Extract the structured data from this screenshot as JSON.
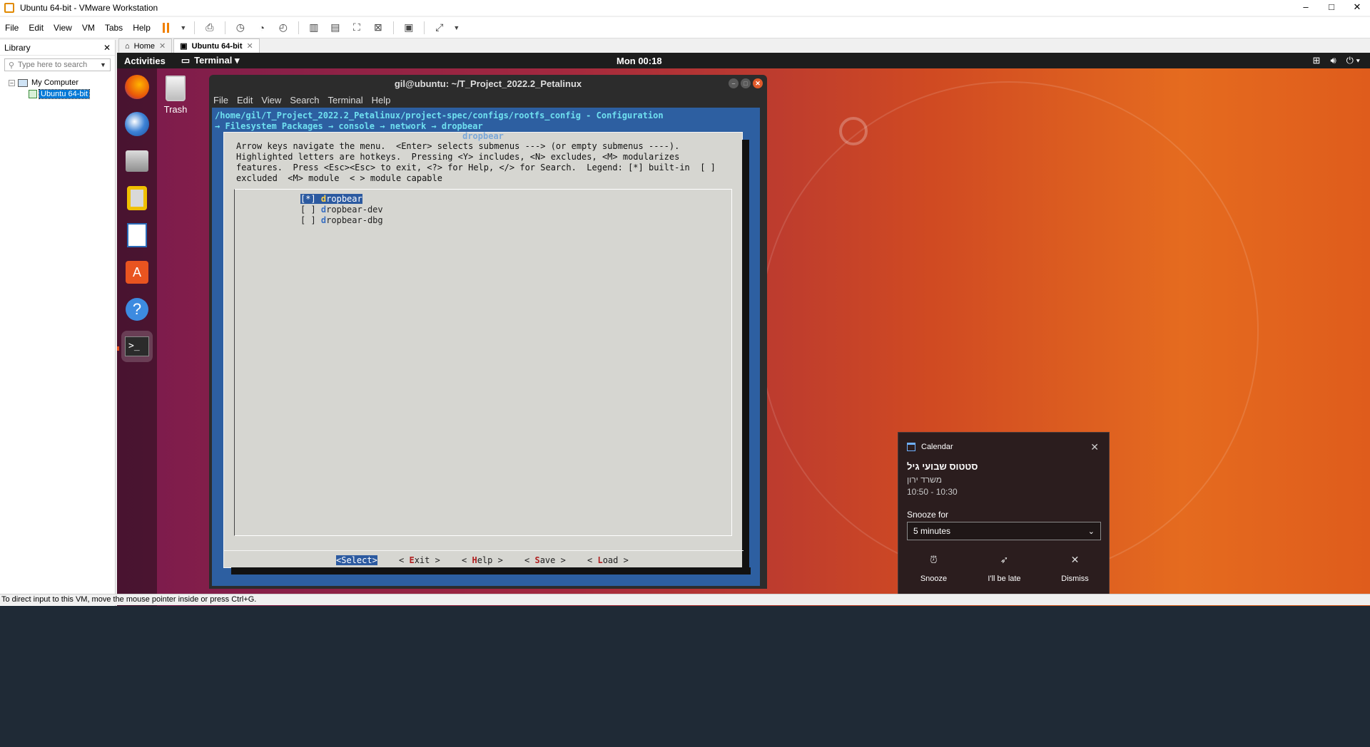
{
  "window": {
    "title": "Ubuntu 64-bit - VMware Workstation",
    "controls": [
      "–",
      "□",
      "✕"
    ]
  },
  "menu": [
    "File",
    "Edit",
    "View",
    "VM",
    "Tabs",
    "Help"
  ],
  "library": {
    "title": "Library",
    "close": "✕",
    "search_placeholder": "Type here to search",
    "tree": {
      "root": "My Computer",
      "root_expander": "–",
      "vm": "Ubuntu 64-bit"
    }
  },
  "tabs": [
    {
      "label": "Home",
      "close": "✕"
    },
    {
      "label": "Ubuntu 64-bit",
      "close": "✕"
    }
  ],
  "ubuntu": {
    "activities": "Activities",
    "app_menu": "Terminal ▾",
    "clock": "Mon 00:18",
    "trash": "Trash",
    "sys_icons": [
      "network-icon",
      "volume-icon",
      "power-icon"
    ]
  },
  "terminal": {
    "title": "gil@ubuntu: ~/T_Project_2022.2_Petalinux",
    "menu": [
      "File",
      "Edit",
      "View",
      "Search",
      "Terminal",
      "Help"
    ],
    "path": "/home/gil/T_Project_2022.2_Petalinux/project-spec/configs/rootfs_config - Configuration",
    "breadcrumb": "→ Filesystem Packages  → console  → network  → dropbear",
    "dialog_title": "dropbear",
    "help_text": "Arrow keys navigate the menu.  <Enter> selects submenus ---> (or empty submenus ----).\nHighlighted letters are hotkeys.  Pressing <Y> includes, <N> excludes, <M> modularizes\nfeatures.  Press <Esc><Esc> to exit, <?> for Help, </> for Search.  Legend: [*] built-in  [ ]\nexcluded  <M> module  < > module capable",
    "options": [
      {
        "box": "[*] ",
        "hotkey": "d",
        "rest": "ropbear",
        "selected": true
      },
      {
        "box": "[ ] ",
        "hotkey": "d",
        "rest": "ropbear-dev",
        "selected": false
      },
      {
        "box": "[ ] ",
        "hotkey": "d",
        "rest": "ropbear-dbg",
        "selected": false
      }
    ],
    "buttons": {
      "select": "<Select>",
      "exit_pre": "< ",
      "exit_hk": "E",
      "exit_post": "xit >",
      "help_pre": "< ",
      "help_hk": "H",
      "help_post": "elp >",
      "save_pre": "< ",
      "save_hk": "S",
      "save_post": "ave >",
      "load_pre": "< ",
      "load_hk": "L",
      "load_post": "oad >"
    }
  },
  "notification": {
    "app": "Calendar",
    "close": "✕",
    "event": "סטטוס שבועי גיל",
    "location": "משרד ירון",
    "time": "10:50 - 10:30",
    "snooze_label": "Snooze for",
    "snooze_value": "5 minutes",
    "actions": {
      "snooze": "Snooze",
      "late": "I'll be late",
      "dismiss": "Dismiss"
    }
  },
  "status": "To direct input to this VM, move the mouse pointer inside or press Ctrl+G."
}
